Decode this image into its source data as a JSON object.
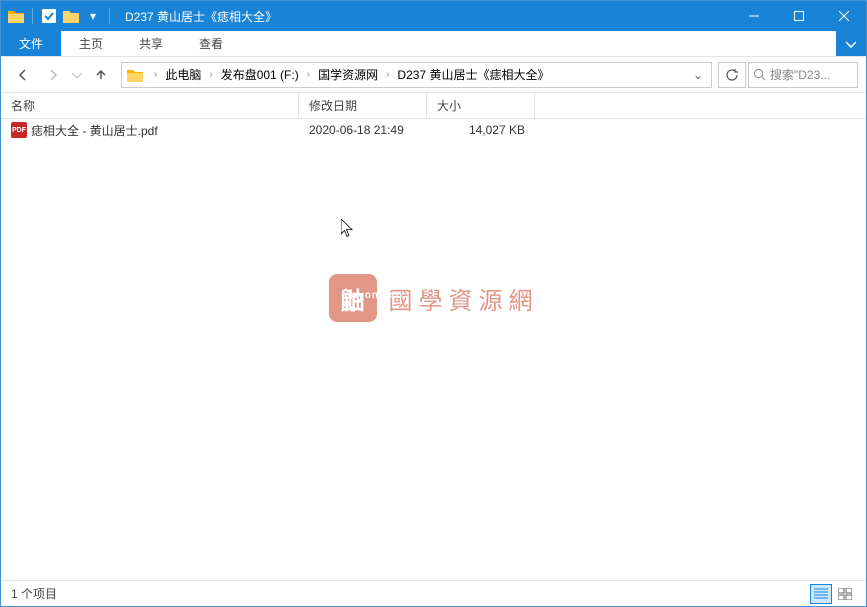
{
  "titlebar": {
    "title": "D237 黄山居士《痣相大全》"
  },
  "ribbon": {
    "file_tab": "文件",
    "tabs": [
      "主页",
      "共享",
      "查看"
    ]
  },
  "breadcrumb": {
    "items": [
      "此电脑",
      "发布盘001 (F:)",
      "国学资源网",
      "D237 黄山居士《痣相大全》"
    ]
  },
  "search": {
    "placeholder": "搜索\"D23..."
  },
  "columns": {
    "name": "名称",
    "date": "修改日期",
    "size": "大小"
  },
  "files": [
    {
      "name": "痣相大全 - 黄山居士.pdf",
      "date": "2020-06-18 21:49",
      "size": "14,027 KB",
      "icon_label": "PDF"
    }
  ],
  "watermark": {
    "badge": "鼬",
    "sub": "nayona.cn",
    "text": "國學資源網"
  },
  "statusbar": {
    "count": "1 个项目"
  }
}
